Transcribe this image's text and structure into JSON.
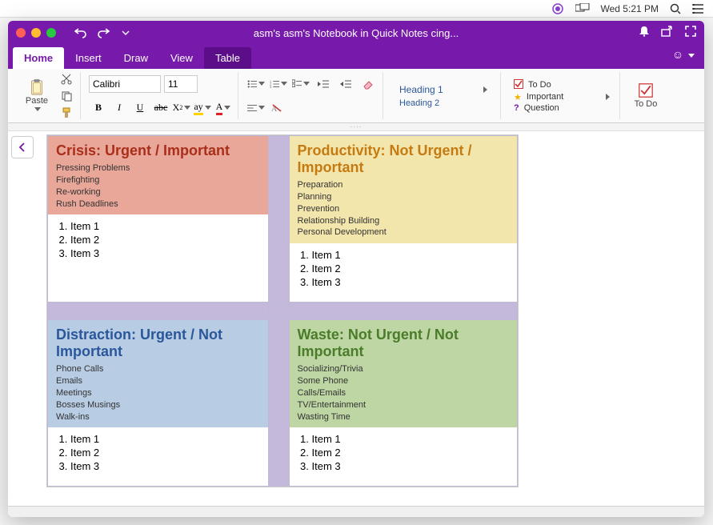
{
  "macbar": {
    "clock": "Wed 5:21 PM"
  },
  "window": {
    "title": "asm's asm's Notebook in Quick Notes cing...",
    "tabs": {
      "home": "Home",
      "insert": "Insert",
      "draw": "Draw",
      "view": "View",
      "table": "Table"
    },
    "ribbon": {
      "paste": "Paste",
      "font_name": "Calibri",
      "font_size": "11",
      "heading1": "Heading 1",
      "heading2": "Heading 2",
      "tags": {
        "todo": "To Do",
        "important": "Important",
        "question": "Question"
      },
      "todo_big": "To Do"
    }
  },
  "matrix": {
    "q1": {
      "title": "Crisis: Urgent / Important",
      "subs": [
        "Pressing Problems",
        "Firefighting",
        "Re-working",
        "Rush Deadlines"
      ],
      "items": [
        "Item 1",
        "Item 2",
        "Item 3"
      ]
    },
    "q2": {
      "title": "Productivity: Not Urgent / Important",
      "subs": [
        "Preparation",
        "Planning",
        "Prevention",
        "Relationship Building",
        "Personal Development"
      ],
      "items": [
        "Item 1",
        "Item 2",
        "Item 3"
      ]
    },
    "q3": {
      "title": "Distraction: Urgent / Not Important",
      "subs": [
        "Phone Calls",
        "Emails",
        "Meetings",
        "Bosses Musings",
        "Walk-ins"
      ],
      "items": [
        "Item 1",
        "Item 2",
        "Item 3"
      ]
    },
    "q4": {
      "title": "Waste: Not Urgent / Not Important",
      "subs": [
        "Socializing/Trivia",
        "Some Phone",
        "Calls/Emails",
        "TV/Entertainment",
        "Wasting Time"
      ],
      "items": [
        "Item 1",
        "Item 2",
        "Item 3"
      ]
    }
  }
}
